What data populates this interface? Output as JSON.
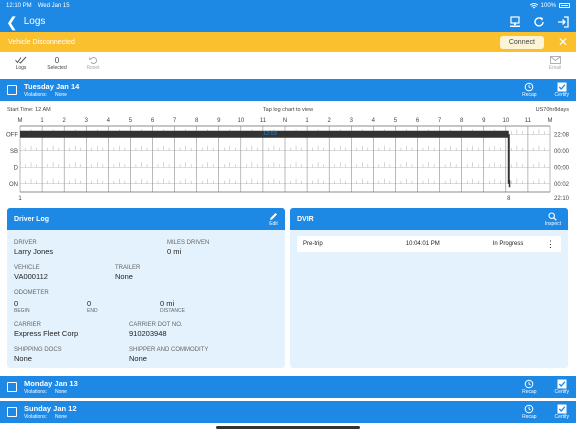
{
  "status_bar": {
    "time": "12:10 PM",
    "date": "Wed Jan 15",
    "battery": "100%"
  },
  "header": {
    "title": "Logs",
    "back_glyph": "❮"
  },
  "banner": {
    "message": "Vehicle Disconnected",
    "connect_label": "Connect",
    "close_glyph": "✕"
  },
  "toolbar": {
    "logs_label": "Logs",
    "selected_count": "0",
    "selected_label": "Selected",
    "reset_label": "Reset",
    "email_label": "Email"
  },
  "days": [
    {
      "date": "Tuesday Jan 14",
      "violations_label": "Violations:",
      "violations": "None",
      "recap_label": "Recap",
      "certify_label": "Certify"
    },
    {
      "date": "Monday Jan 13",
      "violations_label": "Violations:",
      "violations": "None",
      "recap_label": "Recap",
      "certify_label": "Certify"
    },
    {
      "date": "Sunday Jan 12",
      "violations_label": "Violations:",
      "violations": "None",
      "recap_label": "Recap",
      "certify_label": "Certify"
    }
  ],
  "chart": {
    "start_time": "Start Time: 12 AM",
    "tap_hint": "Tap log chart to view",
    "ruleset": "US70hr8days",
    "hour_labels": [
      "M",
      "1",
      "2",
      "3",
      "4",
      "5",
      "6",
      "7",
      "8",
      "9",
      "10",
      "11",
      "N",
      "1",
      "2",
      "3",
      "4",
      "5",
      "6",
      "7",
      "8",
      "9",
      "10",
      "11",
      "M"
    ],
    "status_rows": [
      "OFF",
      "SB",
      "D",
      "ON"
    ],
    "row_totals": [
      "22:08",
      "00:00",
      "00:00",
      "00:02"
    ],
    "total": "22:10",
    "cursor_time": "12:03",
    "left_marker": "1",
    "bottom_marker": "8",
    "segments": [
      {
        "status": "OFF",
        "start_hour": 0,
        "end_hour": 22.133
      },
      {
        "status": "ON",
        "start_hour": 22.133,
        "end_hour": 22.167
      }
    ]
  },
  "driver_log": {
    "title": "Driver Log",
    "edit_label": "Edit",
    "driver_label": "DRIVER",
    "driver": "Larry Jones",
    "miles_label": "MILES DRIVEN",
    "miles": "0 mi",
    "vehicle_label": "VEHICLE",
    "vehicle": "VA000112",
    "trailer_label": "TRAILER",
    "trailer": "None",
    "odometer_label": "ODOMETER",
    "odo_begin": "0",
    "odo_begin_label": "BEGIN",
    "odo_end": "0",
    "odo_end_label": "END",
    "odo_distance": "0 mi",
    "odo_distance_label": "DISTANCE",
    "carrier_label": "CARRIER",
    "carrier": "Express Fleet Corp",
    "dot_label": "CARRIER DOT NO.",
    "dot": "910203948",
    "shipping_label": "SHIPPING DOCS",
    "shipping": "None",
    "shipper_label": "SHIPPER AND COMMODITY",
    "shipper": "None"
  },
  "dvir": {
    "title": "DVIR",
    "inspect_label": "Inspect",
    "rows": [
      {
        "type": "Pre-trip",
        "time": "10:04:01 PM",
        "status": "In Progress",
        "menu_glyph": "⋮"
      }
    ]
  },
  "colors": {
    "primary": "#1e88e5",
    "banner": "#fbc02d",
    "panel_bg": "#e3f2fd"
  }
}
